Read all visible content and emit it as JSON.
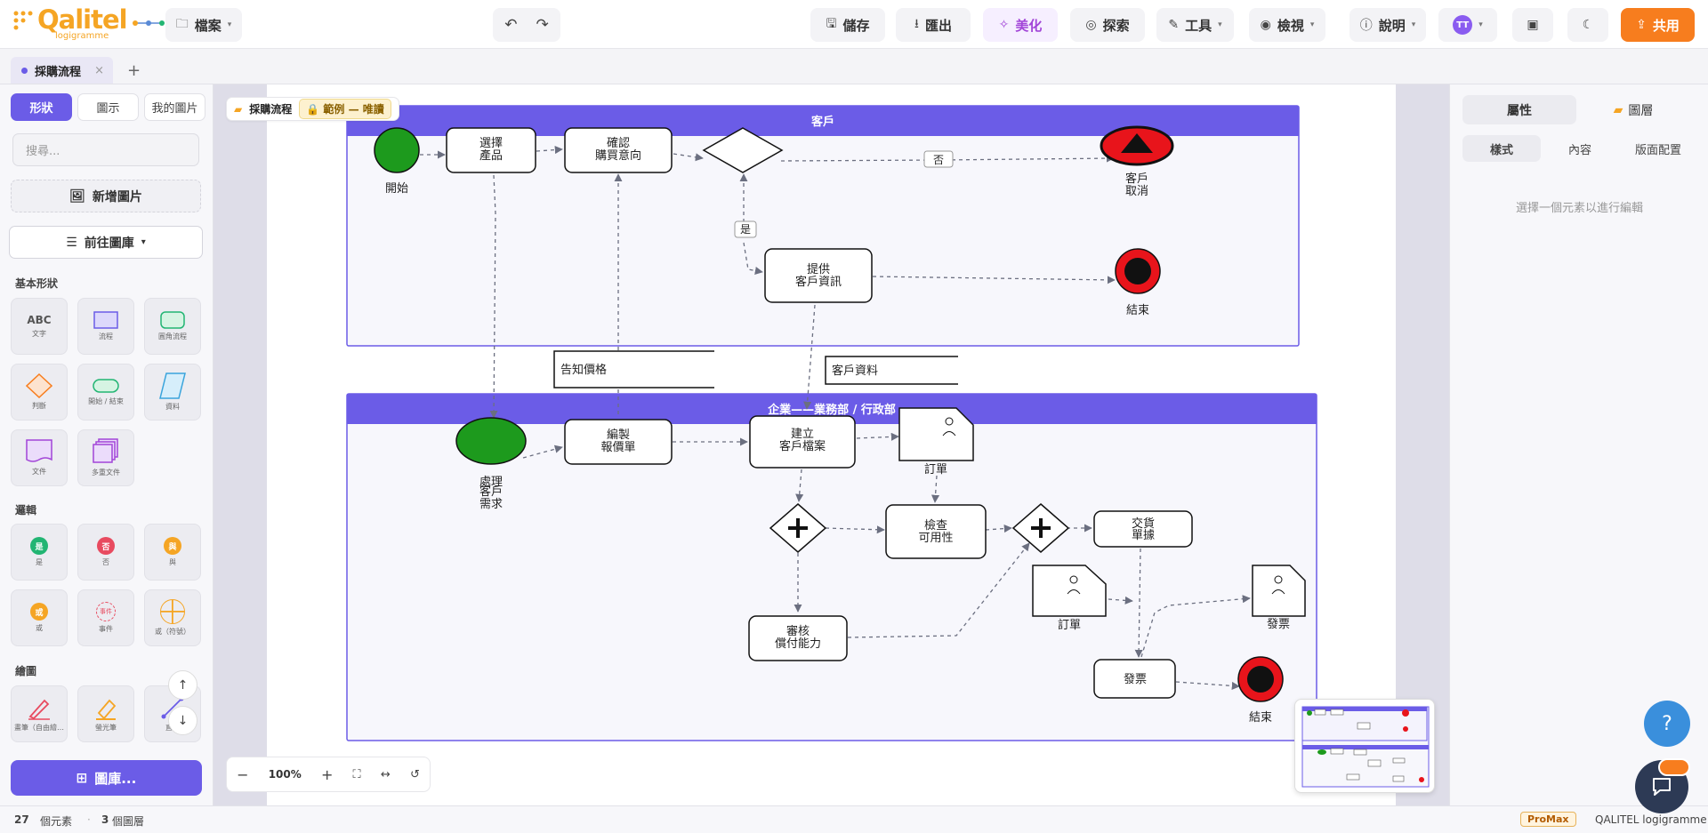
{
  "app": {
    "brand": "Qalitel",
    "brand_sub": "logigramme"
  },
  "toolbar": {
    "file": "檔案",
    "save": "儲存",
    "export": "匯出",
    "beautify": "美化",
    "explore": "探索",
    "tools": "工具",
    "view": "檢視",
    "help": "說明",
    "avatar": "TT",
    "share": "共用"
  },
  "tab": {
    "label": "採購流程",
    "close": "×",
    "add": "+"
  },
  "left": {
    "segments": [
      "形狀",
      "圖示",
      "我的圖片"
    ],
    "search_placeholder": "搜尋...",
    "add_image": "新增圖片",
    "goto_library": "前往圖庫",
    "basic_title": "基本形狀",
    "basic": [
      "文字",
      "流程",
      "圓角流程",
      "判斷",
      "開始 / 結束",
      "資料",
      "文件",
      "多重文件"
    ],
    "abc": "ABC",
    "logic_title": "邏輯",
    "logic": [
      {
        "glyph": "是",
        "caption": "是",
        "color": "#22b573"
      },
      {
        "glyph": "否",
        "caption": "否",
        "color": "#e84a5f"
      },
      {
        "glyph": "與",
        "caption": "與",
        "color": "#f5a524"
      },
      {
        "glyph": "或",
        "caption": "或",
        "color": "#f5a524"
      },
      {
        "glyph": "事件",
        "caption": "事件",
        "color": "#e84a5f"
      },
      {
        "glyph": "",
        "caption": "或（符號）",
        "color": "#f5a524"
      }
    ],
    "draw_title": "繪圖",
    "draw": [
      "畫筆（自由繪…",
      "螢光筆",
      "直線"
    ],
    "library_button": "圖庫...",
    "scroll_up": "↑",
    "scroll_down": "↓"
  },
  "canvas": {
    "breadcrumb": "採購流程",
    "badge": "範例 — 唯讀",
    "lanes": {
      "customer": "客戶",
      "enterprise": "企業——業務部 / 行政部"
    },
    "labels": {
      "start": "開始",
      "select_line1": "選擇",
      "select_line2": "產品",
      "confirm_line1": "確認",
      "confirm_line2": "購買意向",
      "no": "否",
      "yes": "是",
      "cancel_line1": "客戶",
      "cancel_line2": "取消",
      "provide_line1": "提供",
      "provide_line2": "客戶資訊",
      "end1": "結束",
      "quote_note": "告知價格",
      "customer_data": "客戶資料",
      "handle_line1": "處理",
      "handle_line2": "客戶",
      "handle_line3": "需求",
      "draft_line1": "編製",
      "draft_line2": "報價單",
      "create_line1": "建立",
      "create_line2": "客戶檔案",
      "order1": "訂單",
      "check_line1": "檢查",
      "check_line2": "可用性",
      "delivery_line1": "交貨",
      "delivery_line2": "單據",
      "review_line1": "審核",
      "review_line2": "償付能力",
      "order2": "訂單",
      "invoice_doc": "發票",
      "invoice_task": "發票",
      "end2": "結束"
    }
  },
  "zoom": {
    "value": "100%",
    "minus": "−",
    "plus": "+"
  },
  "right": {
    "tabs": [
      "屬性",
      "圖層"
    ],
    "subtabs": [
      "樣式",
      "內容",
      "版面配置"
    ],
    "hint": "選擇一個元素以進行編輯"
  },
  "status": {
    "count": "27",
    "count_label": "個元素",
    "layers": "3",
    "layers_label": "個圖層",
    "badge": "ProMax",
    "product": "QALITEL logigramme"
  },
  "colors": {
    "accent": "#6b5ce7",
    "share": "#f77d1e",
    "start": "#1d9a1d",
    "end": "#e8141b",
    "lane": "#6b5ce7"
  },
  "fab": {
    "help": "?"
  }
}
